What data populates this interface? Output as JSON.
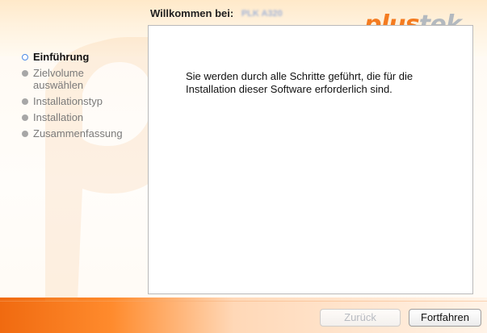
{
  "window": {
    "title": "Willkommen bei:",
    "device_name": "PLK A320"
  },
  "brand": {
    "name_primary": "plus",
    "name_secondary": "tek",
    "primary_color": "#f47b20",
    "secondary_color": "#b3b9bf"
  },
  "sidebar": {
    "steps": [
      {
        "label": "Einführung",
        "state": "current",
        "icon": "current-step-dot-icon"
      },
      {
        "label": "Zielvolume\nauswählen",
        "state": "pending",
        "icon": "step-dot-icon"
      },
      {
        "label": "Installationstyp",
        "state": "pending",
        "icon": "step-dot-icon"
      },
      {
        "label": "Installation",
        "state": "pending",
        "icon": "step-dot-icon"
      },
      {
        "label": "Zusammenfassung",
        "state": "pending",
        "icon": "step-dot-icon"
      }
    ]
  },
  "main": {
    "message": "Sie werden durch alle Schritte geführt, die für die Installation dieser Software erforderlich sind."
  },
  "footer": {
    "back_label": "Zurück",
    "continue_label": "Fortfahren"
  },
  "theme": {
    "active_step_color": "#4b89e6",
    "footer_gradient_start": "#f06a10",
    "footer_gradient_end": "#fff3e7"
  }
}
